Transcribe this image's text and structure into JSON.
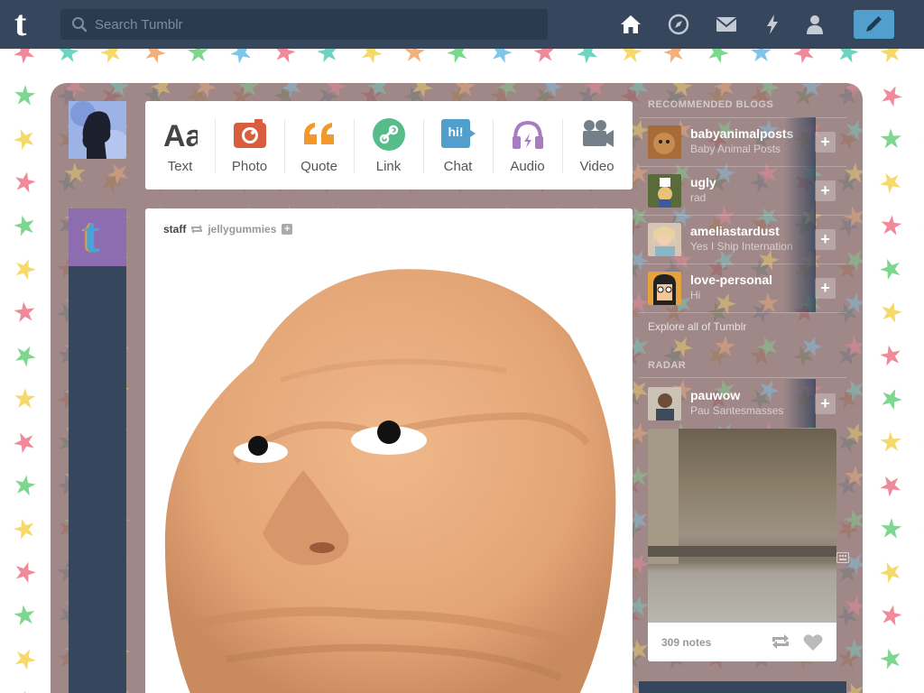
{
  "search": {
    "placeholder": "Search Tumblr"
  },
  "nav": {
    "logo": "t",
    "icons": [
      "home-icon",
      "explore-compass-icon",
      "messages-envelope-icon",
      "activity-lightning-icon",
      "account-person-icon",
      "compose-pencil-icon"
    ]
  },
  "colors": {
    "navbar": "#36465d",
    "compose": "#529ecc",
    "text_post": "#444444",
    "photo_post": "#d95e40",
    "quote_post": "#f2992e",
    "link_post": "#56bc8a",
    "chat_post": "#529ecc",
    "audio_post": "#a77dc2",
    "video_post": "#748089"
  },
  "post_types": [
    {
      "label": "Text",
      "icon": "text-aa-icon"
    },
    {
      "label": "Photo",
      "icon": "camera-icon"
    },
    {
      "label": "Quote",
      "icon": "quote-icon"
    },
    {
      "label": "Link",
      "icon": "link-chain-icon"
    },
    {
      "label": "Chat",
      "icon": "chat-bubble-icon",
      "glyph": "hi!"
    },
    {
      "label": "Audio",
      "icon": "headphones-icon"
    },
    {
      "label": "Video",
      "icon": "video-camera-icon"
    }
  ],
  "post": {
    "author": "staff",
    "reblogged_from": "jellygummies",
    "follow_symbol": "+",
    "image_icon": "clay-face-image"
  },
  "sidebar": {
    "recommended_heading": "RECOMMENDED BLOGS",
    "blogs": [
      {
        "name": "babyanimalposts",
        "title": "Baby Animal Posts"
      },
      {
        "name": "ugly",
        "title": "rad"
      },
      {
        "name": "ameliastardust",
        "title": "Yes I Ship Internation"
      },
      {
        "name": "love-personal",
        "title": "Hi"
      }
    ],
    "follow_symbol": "+",
    "explore_link": "Explore all of Tumblr",
    "radar_heading": "RADAR",
    "radar": {
      "name": "pauwow",
      "title": "Pau Santesmasses",
      "notes": "309 notes"
    }
  }
}
